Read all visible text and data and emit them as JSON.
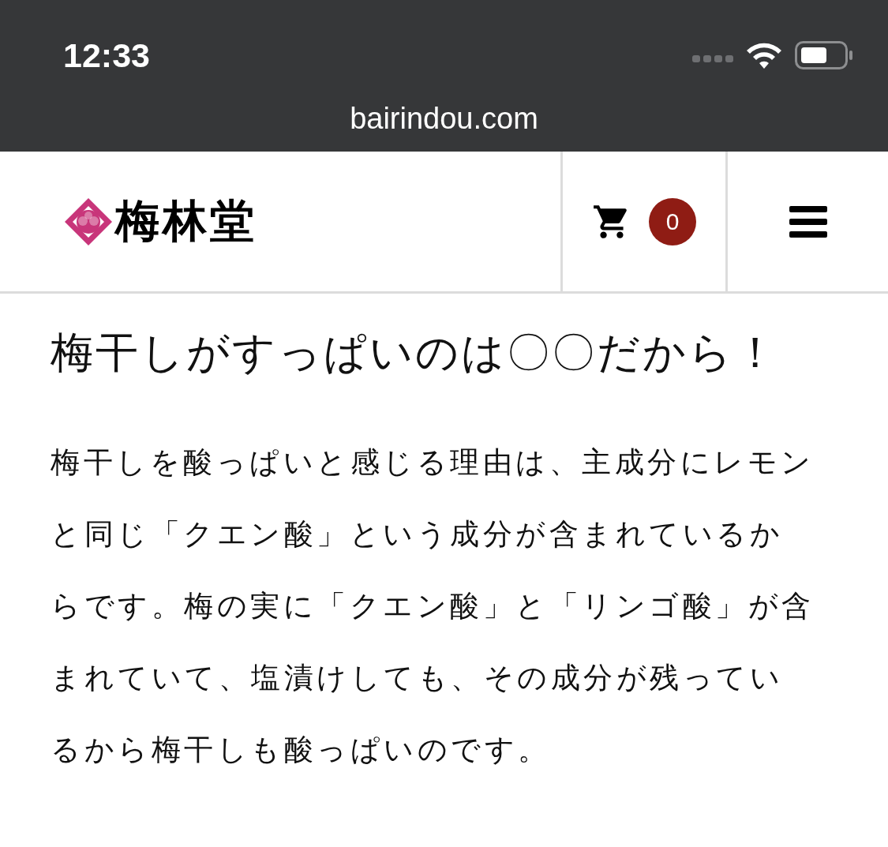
{
  "status_bar": {
    "time": "12:33"
  },
  "address_bar": {
    "url": "bairindou.com"
  },
  "header": {
    "logo_text": "梅林堂",
    "cart_count": "0"
  },
  "article": {
    "title": "梅干しがすっぱいのは〇〇だから！",
    "body": "梅干しを酸っぱいと感じる理由は、主成分にレモンと同じ「クエン酸」という成分が含まれているからです。梅の実に「クエン酸」と「リンゴ酸」が含まれていて、塩漬けしても、その成分が残っているから梅干しも酸っぱいのです。"
  }
}
